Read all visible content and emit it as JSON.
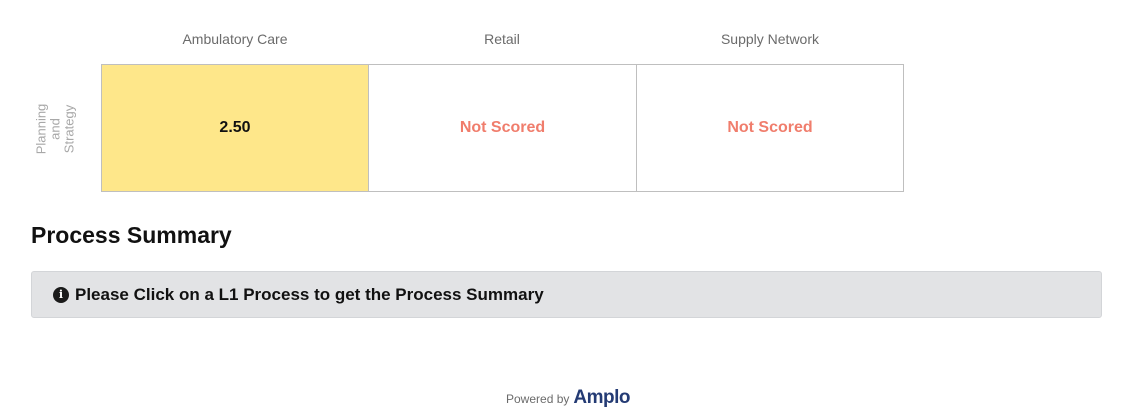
{
  "heatmap": {
    "columns": [
      "Ambulatory Care",
      "Retail",
      "Supply Network"
    ],
    "rows": [
      {
        "label": "Planning and Strategy",
        "cells": [
          {
            "value": "2.50",
            "status": "scored",
            "color": "#fee78a"
          },
          {
            "value": "Not Scored",
            "status": "not-scored",
            "color": "#ffffff"
          },
          {
            "value": "Not Scored",
            "status": "not-scored",
            "color": "#ffffff"
          }
        ]
      }
    ]
  },
  "process_summary": {
    "title": "Process Summary",
    "info_icon": "info-circle-icon",
    "message": "Please Click on a L1 Process to get the Process Summary"
  },
  "footer": {
    "powered_by": "Powered by",
    "brand": "Amplo"
  },
  "colors": {
    "scored_fill": "#fee78a",
    "not_scored_text": "#f07d6c",
    "info_bg": "#e2e3e5",
    "brand": "#243b74"
  }
}
